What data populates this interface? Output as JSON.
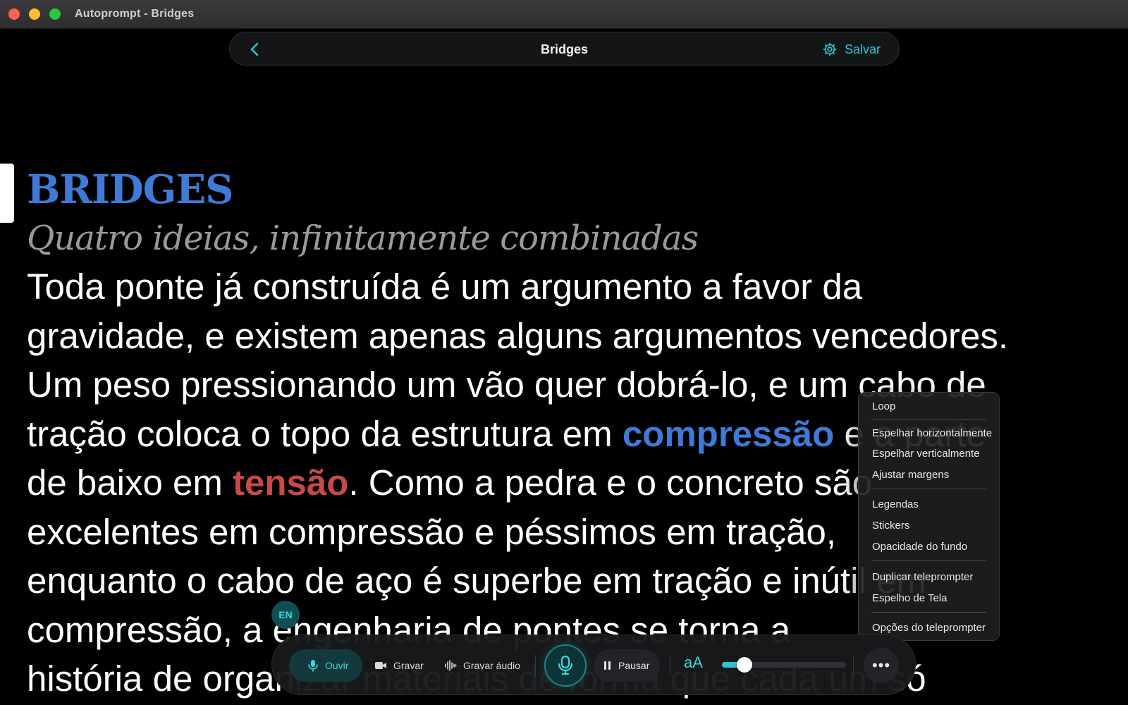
{
  "window": {
    "title": "Autoprompt - Bridges"
  },
  "header": {
    "title": "Bridges",
    "save_label": "Salvar",
    "back_icon": "chevron-left-icon",
    "settings_icon": "gear-icon"
  },
  "script": {
    "title": "BRIDGES",
    "subtitle": "Quatro ideias, infinitamente combinadas",
    "lines": [
      "Toda ponte já construída é um argumento a favor da",
      "gravidade, e existem apenas alguns argumentos vencedores.",
      "Um peso pressionando um vão quer dobrá-lo, e um cabo de",
      {
        "before": "tração coloca o topo da estrutura em ",
        "kw": "compressão",
        "after": " e a parte"
      },
      {
        "before": "de baixo em ",
        "kw": "tensão",
        "after": ". Como a pedra e o concreto são"
      },
      "excelentes em compressão e péssimos em tração,",
      "enquanto o cabo de aço é superbe em tração e inútil em",
      "compressão, a engenharia de pontes se torna a",
      "história de organizar materiais de forma que cada um só"
    ]
  },
  "colors": {
    "accent": "#2ec5d3",
    "keyword_blue": "#3f7ad6",
    "keyword_red": "#c64a4a"
  },
  "menu": {
    "groups": [
      [
        "Loop"
      ],
      [
        "Espelhar horizontalmente",
        "Espelhar verticalmente",
        "Ajustar margens"
      ],
      [
        "Legendas",
        "Stickers",
        "Opacidade do fundo"
      ],
      [
        "Duplicar teleprompter",
        "Espelho de Tela"
      ],
      [
        "Opções do teleprompter"
      ]
    ]
  },
  "language": {
    "code": "EN"
  },
  "toolbar": {
    "listen_label": "Ouvir",
    "record_label": "Gravar",
    "record_audio_label": "Gravar áudio",
    "pause_label": "Pausar",
    "font_size_label": "aA",
    "speed_value": 0.18,
    "more_label": "•••"
  }
}
